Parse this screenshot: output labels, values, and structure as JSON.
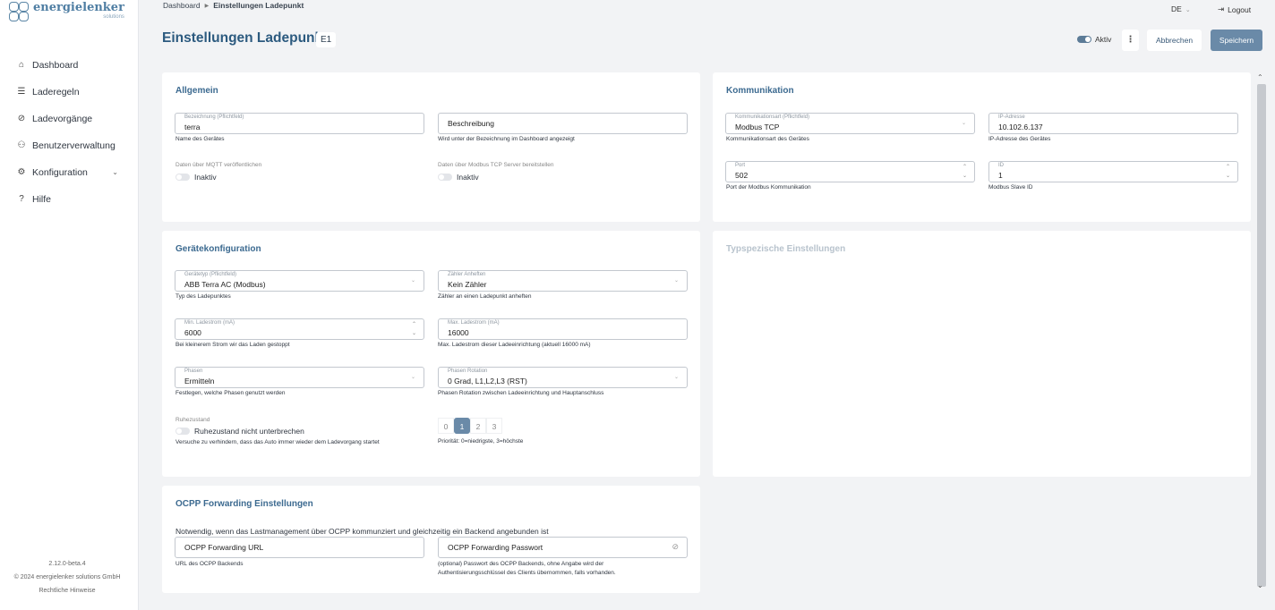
{
  "brand": {
    "name": "energielenker",
    "sub": "solutions"
  },
  "nav": [
    {
      "label": "Dashboard",
      "icon": "home-icon"
    },
    {
      "label": "Laderegeln",
      "icon": "rules-icon"
    },
    {
      "label": "Ladevorgänge",
      "icon": "charging-icon"
    },
    {
      "label": "Benutzerverwaltung",
      "icon": "users-icon"
    },
    {
      "label": "Konfiguration",
      "icon": "gear-icon"
    },
    {
      "label": "Hilfe",
      "icon": "help-icon"
    }
  ],
  "footer": {
    "version": "2.12.0-beta.4",
    "copyright": "© 2024 energielenker solutions GmbH",
    "legal": "Rechtliche Hinweise"
  },
  "breadcrumb": {
    "root": "Dashboard",
    "current": "Einstellungen Ladepunkt"
  },
  "topbar": {
    "lang": "DE",
    "logout": "Logout"
  },
  "header": {
    "title": "Einstellungen Ladepunkt",
    "badge": "E1",
    "active_label": "Aktiv",
    "active": true,
    "more": "⋮",
    "cancel": "Abbrechen",
    "save": "Speichern"
  },
  "allgemein": {
    "title": "Allgemein",
    "name": {
      "label": "Bezeichnung (Pflichtfeld)",
      "value": "terra",
      "hint": "Name des Gerätes"
    },
    "description": {
      "placeholder": "Beschreibung",
      "hint": "Wird unter der Bezeichnung im Dashboard angezeigt"
    },
    "mqtt": {
      "label": "Daten über MQTT veröffentlichen",
      "state": "Inaktiv"
    },
    "modbus_server": {
      "label": "Daten über Modbus TCP Server bereitstellen",
      "state": "Inaktiv"
    }
  },
  "kommunikation": {
    "title": "Kommunikation",
    "type": {
      "label": "Kommunikationsart (Pflichtfeld)",
      "value": "Modbus TCP",
      "hint": "Kommunikationsart des Gerätes"
    },
    "ip": {
      "label": "IP-Adresse",
      "value": "10.102.6.137",
      "hint": "IP-Adresse des Gerätes"
    },
    "port": {
      "label": "Port",
      "value": "502",
      "hint": "Port der Modbus Kommunikation"
    },
    "id": {
      "label": "ID",
      "value": "1",
      "hint": "Modbus Slave ID"
    }
  },
  "geraet": {
    "title": "Gerätekonfiguration",
    "type": {
      "label": "Gerätetyp (Pflichtfeld)",
      "value": "ABB Terra AC (Modbus)",
      "hint": "Typ des Ladepunktes"
    },
    "meter": {
      "label": "Zähler Anheften",
      "value": "Kein Zähler",
      "hint": "Zähler an einen Ladepunkt anheften"
    },
    "min": {
      "label": "Min. Ladestrom (mA)",
      "value": "6000",
      "hint": "Bei kleinerem Strom wir das Laden gestoppt"
    },
    "max": {
      "label": "Max. Ladestrom (mA)",
      "value": "16000",
      "hint": "Max. Ladestrom dieser Ladeeinrichtung (aktuell 16000 mA)"
    },
    "phases": {
      "label": "Phasen",
      "value": "Ermitteln",
      "hint": "Festlegen, welche Phasen genutzt werden"
    },
    "rotation": {
      "label": "Phasen Rotation",
      "value": "0 Grad, L1,L2,L3 (RST)",
      "hint": "Phasen Rotation zwischen Ladeeinrichtung und Hauptanschluss"
    },
    "idle": {
      "label": "Ruhezustand",
      "state": "Ruhezustand nicht unterbrechen",
      "hint": "Versuche zu verhindern, dass das Auto immer wieder dem Ladevorgang startet"
    },
    "priority": {
      "options": [
        "0",
        "1",
        "2",
        "3"
      ],
      "selected": "1",
      "hint": "Priorität: 0=niedrigste, 3=höchste"
    }
  },
  "typspezifisch": {
    "title": "Typspezische Einstellungen"
  },
  "ocpp": {
    "title": "OCPP Forwarding Einstellungen",
    "note": "Notwendig, wenn das Lastmanagement über OCPP kommunziert und gleichzeitig ein Backend angebunden ist",
    "url": {
      "placeholder": "OCPP Forwarding URL",
      "hint": "URL des OCPP Backends"
    },
    "password": {
      "placeholder": "OCPP Forwarding Passwort",
      "hint1": "(optional) Passwort des OCPP Backends, ohne Angabe wird der",
      "hint2": "Authentisierungsschlüssel des Clients übernommen, falls vorhanden."
    }
  }
}
